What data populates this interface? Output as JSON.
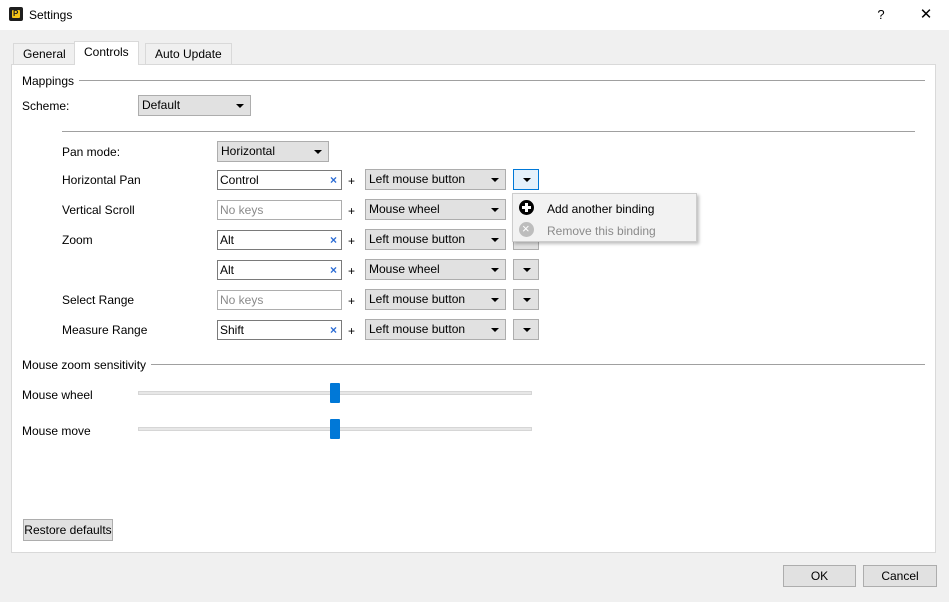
{
  "window": {
    "title": "Settings",
    "help_label": "?",
    "close_label": "✕"
  },
  "tabs": [
    {
      "label": "General"
    },
    {
      "label": "Controls"
    },
    {
      "label": "Auto Update"
    }
  ],
  "mappings": {
    "group_label": "Mappings",
    "scheme_label": "Scheme:",
    "scheme_value": "Default",
    "pan_mode_label": "Pan mode:",
    "pan_mode_value": "Horizontal",
    "plus": "+",
    "rows": [
      {
        "label": "Horizontal Pan",
        "keys": "Control",
        "keys_empty": false,
        "button": "Left mouse button"
      },
      {
        "label": "Vertical Scroll",
        "keys": "No keys",
        "keys_empty": true,
        "button": "Mouse wheel"
      },
      {
        "label": "Zoom",
        "keys": "Alt",
        "keys_empty": false,
        "button": "Left mouse button"
      },
      {
        "label": "",
        "keys": "Alt",
        "keys_empty": false,
        "button": "Mouse wheel"
      },
      {
        "label": "Select Range",
        "keys": "No keys",
        "keys_empty": true,
        "button": "Left mouse button"
      },
      {
        "label": "Measure Range",
        "keys": "Shift",
        "keys_empty": false,
        "button": "Left mouse button"
      }
    ],
    "clear_glyph": "×"
  },
  "binding_menu": {
    "add_label": "Add another binding",
    "remove_label": "Remove this binding"
  },
  "zoom_sensitivity": {
    "group_label": "Mouse zoom sensitivity",
    "mouse_wheel_label": "Mouse wheel",
    "mouse_wheel_value": 0.5,
    "mouse_move_label": "Mouse move",
    "mouse_move_value": 0.5
  },
  "buttons": {
    "restore_defaults": "Restore defaults",
    "ok": "OK",
    "cancel": "Cancel"
  },
  "colors": {
    "accent": "#0078d7",
    "clear_x": "#2b6cd4"
  }
}
